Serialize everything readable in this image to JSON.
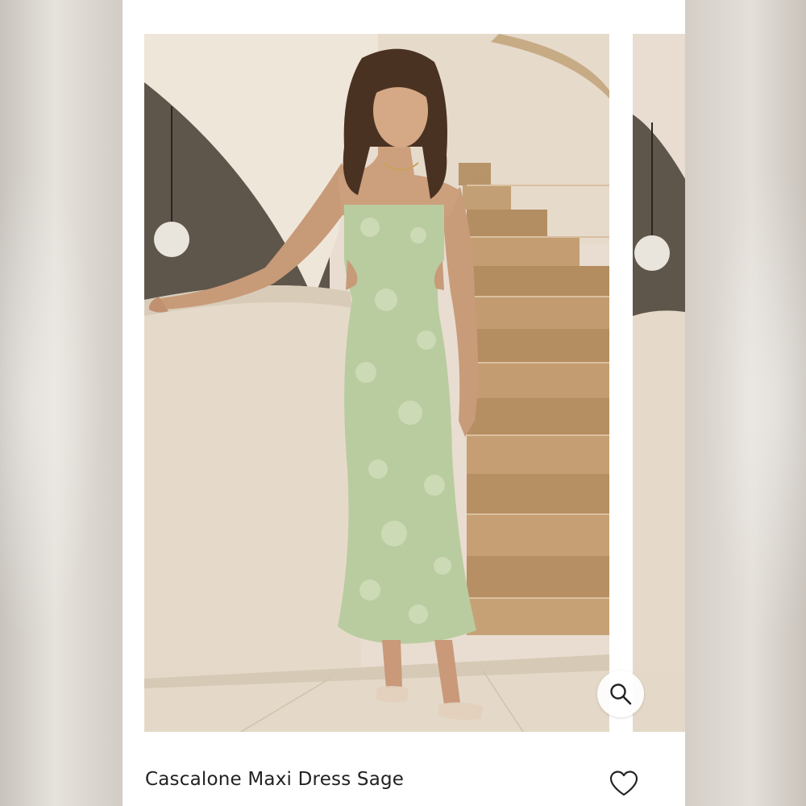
{
  "product": {
    "title": "Cascalone Maxi Dress Sage",
    "image_subject": "model-wearing-sage-maxi-dress"
  },
  "actions": {
    "zoom_icon": "magnifier-icon",
    "wishlist_icon": "heart-outline-icon"
  },
  "colors": {
    "dress": "#b9cc9f",
    "page_background": "#ffffff",
    "text": "#222222"
  }
}
